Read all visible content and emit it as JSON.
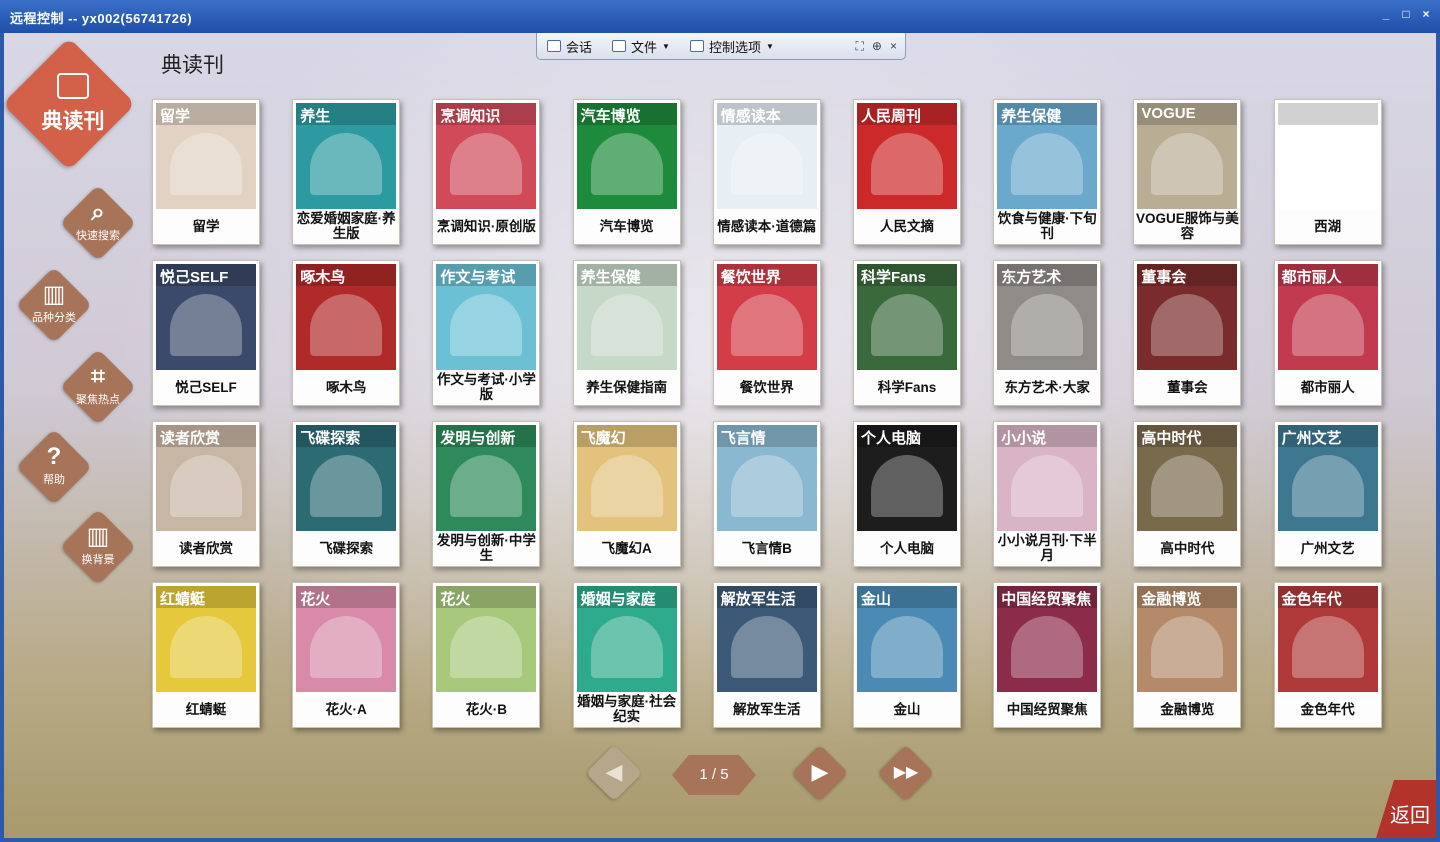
{
  "window": {
    "title": "远程控制 -- yx002(56741726)",
    "buttons": [
      "_",
      "□",
      "×"
    ]
  },
  "toolbar": {
    "chat": "会话",
    "file": "文件",
    "control": "控制选项",
    "close": "×"
  },
  "section_title": "典读刊",
  "hero": {
    "label": "典读刊",
    "icon": "magazine-stack-icon"
  },
  "sidebar": [
    {
      "id": "search",
      "label": "快速搜索",
      "icon": "search-icon",
      "glyph": "⌕"
    },
    {
      "id": "category",
      "label": "品种分类",
      "icon": "book-icon",
      "glyph": "▥"
    },
    {
      "id": "focus",
      "label": "聚焦热点",
      "icon": "focus-icon",
      "glyph": "⌗"
    },
    {
      "id": "help",
      "label": "帮助",
      "icon": "question-icon",
      "glyph": "?"
    },
    {
      "id": "background",
      "label": "换背景",
      "icon": "book-open-icon",
      "glyph": "▥"
    }
  ],
  "magazines": [
    {
      "title": "留学",
      "mast": "留学",
      "color": "#e2d2c4"
    },
    {
      "title": "恋爱婚姻家庭·养生版",
      "mast": "养生",
      "color": "#2c9aa0"
    },
    {
      "title": "烹调知识·原创版",
      "mast": "烹调知识",
      "color": "#d14a5a"
    },
    {
      "title": "汽车博览",
      "mast": "汽车博览",
      "color": "#1e8a3c"
    },
    {
      "title": "情感读本·道德篇",
      "mast": "情感读本",
      "color": "#e7eef4"
    },
    {
      "title": "人民文摘",
      "mast": "人民周刊",
      "color": "#cc2a2a"
    },
    {
      "title": "饮食与健康·下旬刊",
      "mast": "养生保健",
      "color": "#6aa8cc"
    },
    {
      "title": "VOGUE服饰与美容",
      "mast": "VOGUE",
      "color": "#b9ad94"
    },
    {
      "title": "西湖",
      "mast": "",
      "color": "#ffffff"
    },
    {
      "title": "悦己SELF",
      "mast": "悦己SELF",
      "color": "#3b4a6a"
    },
    {
      "title": "啄木鸟",
      "mast": "啄木鸟",
      "color": "#b02a2a"
    },
    {
      "title": "作文与考试·小学版",
      "mast": "作文与考试",
      "color": "#6cc0d4"
    },
    {
      "title": "养生保健指南",
      "mast": "养生保健",
      "color": "#c6d8c8"
    },
    {
      "title": "餐饮世界",
      "mast": "餐饮世界",
      "color": "#d23d48"
    },
    {
      "title": "科学Fans",
      "mast": "科学Fans",
      "color": "#3a6a3c"
    },
    {
      "title": "东方艺术·大家",
      "mast": "东方艺术",
      "color": "#8f8c88"
    },
    {
      "title": "董事会",
      "mast": "董事会",
      "color": "#7a2c2c"
    },
    {
      "title": "都市丽人",
      "mast": "都市丽人",
      "color": "#c23a4e"
    },
    {
      "title": "读者欣赏",
      "mast": "读者欣赏",
      "color": "#c8b6a4"
    },
    {
      "title": "飞碟探索",
      "mast": "飞碟探索",
      "color": "#2c6a74"
    },
    {
      "title": "发明与创新·中学生",
      "mast": "发明与创新",
      "color": "#2e8a5a"
    },
    {
      "title": "飞魔幻A",
      "mast": "飞魔幻",
      "color": "#e2c27c"
    },
    {
      "title": "飞言情B",
      "mast": "飞言情",
      "color": "#8ab8d0"
    },
    {
      "title": "个人电脑",
      "mast": "个人电脑",
      "color": "#1d1d1d"
    },
    {
      "title": "小小说月刊·下半月",
      "mast": "小小说",
      "color": "#d9b4c6"
    },
    {
      "title": "高中时代",
      "mast": "高中时代",
      "color": "#7a6a4c"
    },
    {
      "title": "广州文艺",
      "mast": "广州文艺",
      "color": "#3d7890"
    },
    {
      "title": "红蜻蜓",
      "mast": "红蜻蜓",
      "color": "#e6c83c"
    },
    {
      "title": "花火·A",
      "mast": "花火",
      "color": "#d88aa8"
    },
    {
      "title": "花火·B",
      "mast": "花火",
      "color": "#a8c87c"
    },
    {
      "title": "婚姻与家庭·社会纪实",
      "mast": "婚姻与家庭",
      "color": "#2eaa8c"
    },
    {
      "title": "解放军生活",
      "mast": "解放军生活",
      "color": "#3c5a78"
    },
    {
      "title": "金山",
      "mast": "金山",
      "color": "#4a8ab4"
    },
    {
      "title": "中国经贸聚焦",
      "mast": "中国经贸聚焦",
      "color": "#8c2c4a"
    },
    {
      "title": "金融博览",
      "mast": "金融博览",
      "color": "#b48a6a"
    },
    {
      "title": "金色年代",
      "mast": "金色年代",
      "color": "#b03a3a"
    }
  ],
  "pager": {
    "indicator": "1 / 5",
    "prev": "◀",
    "next": "▶",
    "last": "▶▶"
  },
  "back_label": "返回"
}
